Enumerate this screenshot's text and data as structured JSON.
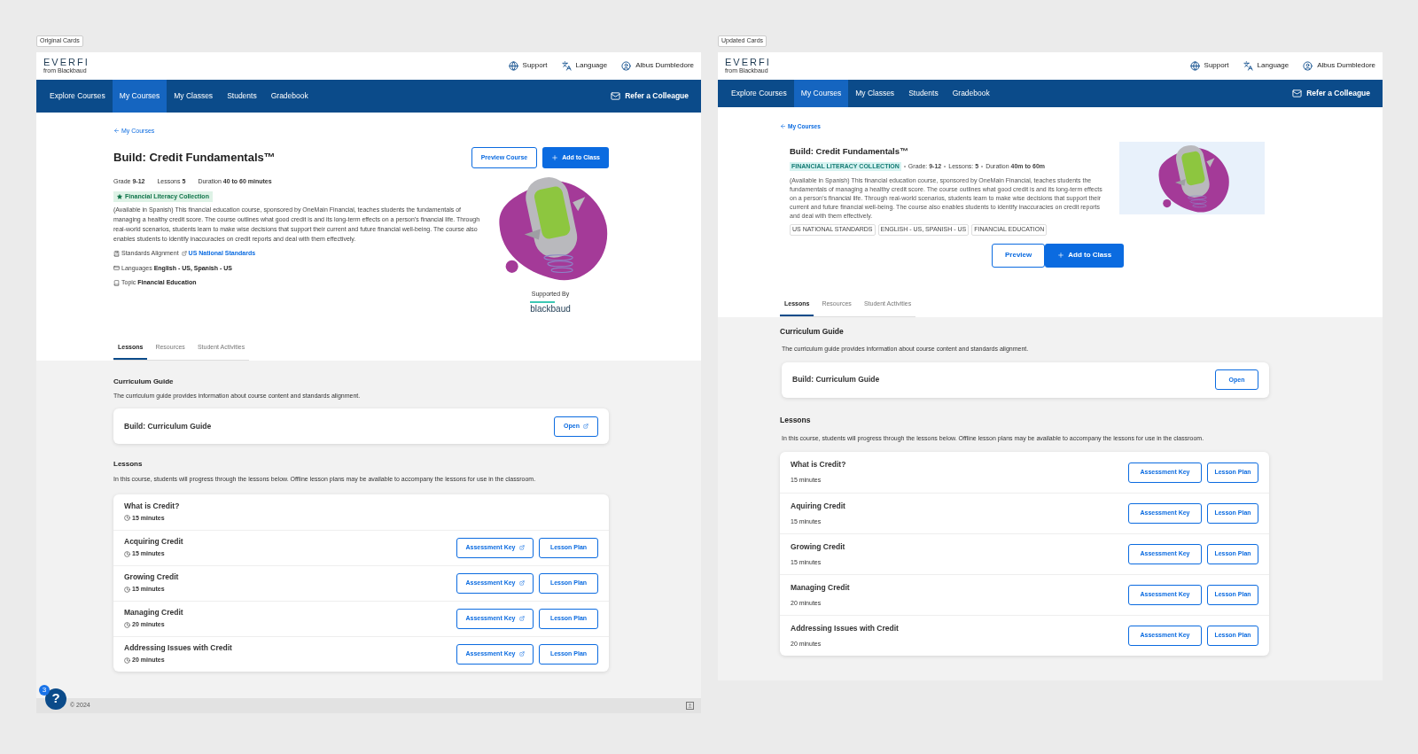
{
  "panels": [
    {
      "kind": "original",
      "label": "Original Cards",
      "header": {
        "logo": "EVERFI",
        "logo_sub": "from Blackbaud",
        "links": [
          {
            "kind": "globe",
            "label": "Support"
          },
          {
            "kind": "translate",
            "label": "Language"
          },
          {
            "kind": "user",
            "label": "Albus Dumbledore"
          }
        ]
      },
      "nav": {
        "items": [
          {
            "label": "Explore Courses",
            "selected": false
          },
          {
            "label": "My Courses",
            "selected": true
          },
          {
            "label": "My Classes",
            "selected": false
          },
          {
            "label": "Students",
            "selected": false
          },
          {
            "label": "Gradebook",
            "selected": false
          }
        ],
        "refer": "Refer a Colleague"
      },
      "back_link": "My Courses",
      "course": {
        "title": "Build: Credit Fundamentals™",
        "meta": [
          {
            "label": "Grade",
            "value": "9-12"
          },
          {
            "label": "Lessons",
            "value": "5"
          },
          {
            "label": "Duration",
            "value": "40 to 60 minutes"
          }
        ],
        "collection": "Financial Literacy Collection",
        "description": "(Available in Spanish) This financial education course, sponsored by OneMain Financial, teaches students the fundamentals of managing a healthy credit score. The course outlines what good credit is and its long-term effects on a person’s financial life. Through real-world scenarios, students learn to make wise decisions that support their current and future financial well-being. The course also enables students to identify inaccuracies on credit reports and deal with them effectively.",
        "details": [
          {
            "kind": "standards",
            "label": "Standards Alignment",
            "link": "US National Standards"
          },
          {
            "kind": "languages",
            "label": "Languages",
            "value": "English - US, Spanish - US"
          },
          {
            "kind": "topic",
            "label": "Topic",
            "value": "Financial Education"
          }
        ],
        "buttons": [
          {
            "kind": "outline",
            "label": "Preview Course"
          },
          {
            "kind": "primary",
            "label": "Add to Class"
          }
        ],
        "supported_by": "Supported By",
        "sponsor": "blackbaud"
      },
      "tabs": [
        {
          "label": "Lessons",
          "selected": true
        },
        {
          "label": "Resources",
          "selected": false
        },
        {
          "label": "Student Activities",
          "selected": false
        }
      ],
      "curriculum": {
        "heading": "Curriculum Guide",
        "description": "The curriculum guide provides information about course content and standards alignment.",
        "card_title": "Build: Curriculum Guide",
        "button": {
          "label": "Open",
          "external": true
        }
      },
      "lessons": {
        "heading": "Lessons",
        "description": "In this course, students will progress through the lessons below. Offline lesson plans may be available to accompany the lessons for use in the classroom.",
        "rows": [
          {
            "title": "What is Credit?",
            "duration": "15 minutes"
          },
          {
            "title": "Acquiring Credit",
            "duration": "15 minutes",
            "buttons": [
              {
                "label": "Assessment Key",
                "external": true
              },
              {
                "label": "Lesson Plan",
                "external": false
              }
            ]
          },
          {
            "title": "Growing Credit",
            "duration": "15 minutes",
            "buttons": [
              {
                "label": "Assessment Key",
                "external": true
              },
              {
                "label": "Lesson Plan",
                "external": false
              }
            ]
          },
          {
            "title": "Managing Credit",
            "duration": "20 minutes",
            "buttons": [
              {
                "label": "Assessment Key",
                "external": true
              },
              {
                "label": "Lesson Plan",
                "external": false
              }
            ]
          },
          {
            "title": "Addressing Issues with Credit",
            "duration": "20 minutes",
            "buttons": [
              {
                "label": "Assessment Key",
                "external": true
              },
              {
                "label": "Lesson Plan",
                "external": false
              }
            ]
          }
        ]
      },
      "footer": {
        "copyright": "© 2024",
        "help": "?",
        "badge": "3"
      }
    },
    {
      "kind": "updated",
      "label": "Updated Cards",
      "header": {
        "logo": "EVERFI",
        "logo_sub": "from Blackbaud",
        "links": [
          {
            "kind": "globe",
            "label": "Support"
          },
          {
            "kind": "translate",
            "label": "Language"
          },
          {
            "kind": "user",
            "label": "Albus Dumbledore"
          }
        ]
      },
      "nav": {
        "items": [
          {
            "label": "Explore Courses",
            "selected": false
          },
          {
            "label": "My Courses",
            "selected": true
          },
          {
            "label": "My Classes",
            "selected": false
          },
          {
            "label": "Students",
            "selected": false
          },
          {
            "label": "Gradebook",
            "selected": false
          }
        ],
        "refer": "Refer a Colleague"
      },
      "back_link": "My Courses",
      "course": {
        "title": "Build: Credit Fundamentals™",
        "meta": [
          {
            "label": "Grade:",
            "value": "9-12"
          },
          {
            "label": "Lessons:",
            "value": "5"
          },
          {
            "label": "Duration",
            "value": "40m to 60m"
          }
        ],
        "collection": "FINANCIAL LITERACY COLLECTION",
        "description": "(Available in Spanish) This financial education course, sponsored by OneMain Financial, teaches students the fundamentals of managing a healthy credit score. The course outlines what good credit is and its long-term effects on a person’s financial life. Through real-world scenarios, students learn to make wise decisions that support their current and future financial well-being. The course also enables students to identify inaccuracies on credit reports and deal with them effectively.",
        "tags": [
          "US NATIONAL STANDARDS",
          "ENGLISH - US, SPANISH - US",
          "FINANCIAL EDUCATION"
        ],
        "buttons": [
          {
            "kind": "outline",
            "label": "Preview"
          },
          {
            "kind": "primary",
            "label": "Add to Class"
          }
        ]
      },
      "tabs": [
        {
          "label": "Lessons",
          "selected": true
        },
        {
          "label": "Resources",
          "selected": false
        },
        {
          "label": "Student Activities",
          "selected": false
        }
      ],
      "curriculum": {
        "heading": "Curriculum Guide",
        "description": "The curriculum guide provides information about course content and standards alignment.",
        "card_title": "Build: Curriculum Guide",
        "button": {
          "label": "Open",
          "external": false
        }
      },
      "lessons": {
        "heading": "Lessons",
        "description": "In this course, students will progress through the lessons below. Offline lesson plans may be available to accompany the lessons for use in the classroom.",
        "rows": [
          {
            "title": "What is Credit?",
            "duration": "15 minutes",
            "buttons": [
              {
                "label": "Assessment Key",
                "external": false
              },
              {
                "label": "Lesson Plan",
                "external": false
              }
            ]
          },
          {
            "title": "Aquiring Credit",
            "duration": "15 minutes",
            "buttons": [
              {
                "label": "Assessment Key",
                "external": false
              },
              {
                "label": "Lesson Plan",
                "external": false
              }
            ]
          },
          {
            "title": "Growing Credit",
            "duration": "15 minutes",
            "buttons": [
              {
                "label": "Assessment Key",
                "external": false
              },
              {
                "label": "Lesson Plan",
                "external": false
              }
            ]
          },
          {
            "title": "Managing Credit",
            "duration": "20 minutes",
            "buttons": [
              {
                "label": "Assessment Key",
                "external": false
              },
              {
                "label": "Lesson Plan",
                "external": false
              }
            ]
          },
          {
            "title": "Addressing Issues with Credit",
            "duration": "20 minutes",
            "buttons": [
              {
                "label": "Assessment Key",
                "external": false
              },
              {
                "label": "Lesson Plan",
                "external": false
              }
            ]
          }
        ]
      }
    }
  ]
}
